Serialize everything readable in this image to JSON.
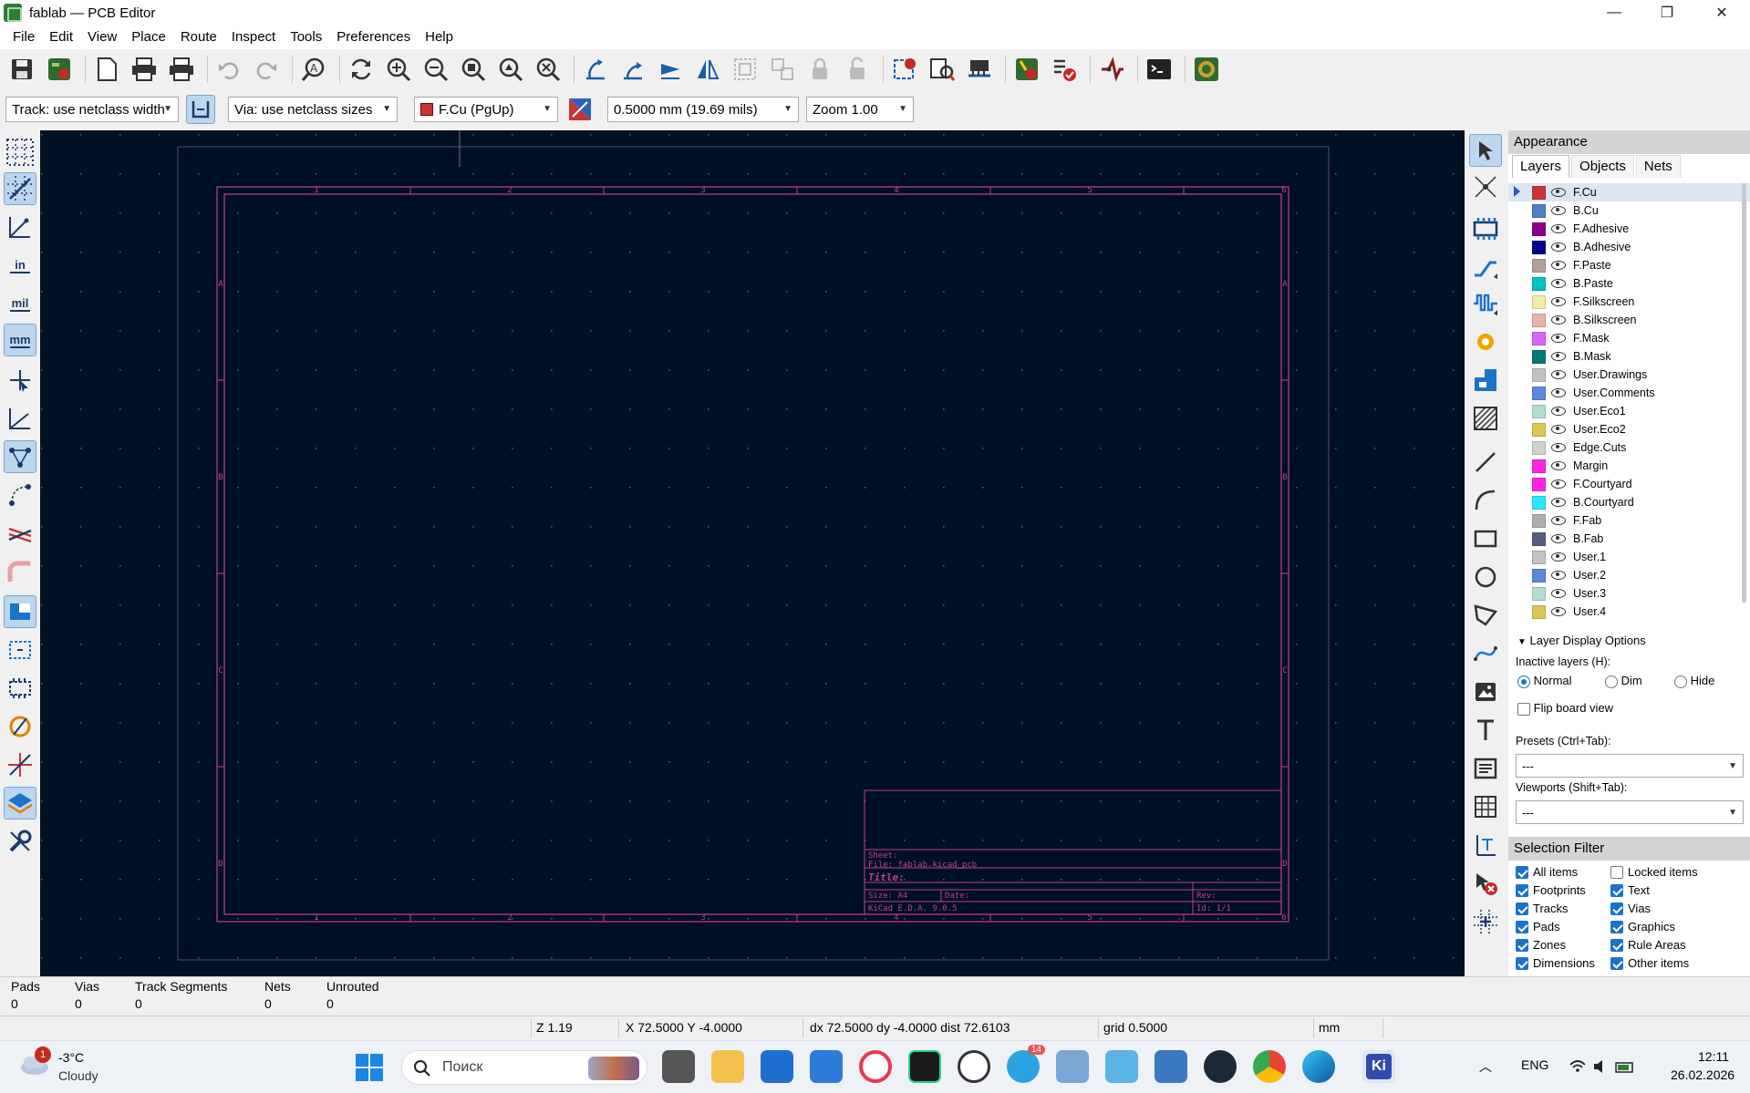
{
  "window": {
    "title": "fablab — PCB Editor",
    "minimize": "—",
    "maximize": "❐",
    "close": "✕"
  },
  "menu": [
    "File",
    "Edit",
    "View",
    "Place",
    "Route",
    "Inspect",
    "Tools",
    "Preferences",
    "Help"
  ],
  "toolbar2": {
    "track_width": "Track: use netclass width",
    "via_size": "Via: use netclass sizes",
    "layer": "F.Cu (PgUp)",
    "grid": "0.5000 mm (19.69 mils)",
    "zoom": "Zoom 1.00"
  },
  "left_toolbar": {
    "inch_label": "in",
    "mil_label": "mil",
    "mm_label": "mm"
  },
  "sheet": {
    "col_labels": [
      "1",
      "2",
      "3",
      "4",
      "5",
      "6"
    ],
    "row_labels": [
      "A",
      "B",
      "C",
      "D"
    ],
    "sheet_label": "Sheet:",
    "file_label": "File: fablab.kicad_pcb",
    "title_label": "Title:",
    "size_label": "Size: A4",
    "date_label": "Date:",
    "rev_label": "Rev:",
    "kicad_label": "KiCad E.D.A. 9.0.5",
    "id_label": "Id: 1/1"
  },
  "appearance": {
    "header": "Appearance",
    "tabs": [
      "Layers",
      "Objects",
      "Nets"
    ],
    "layers": [
      {
        "name": "F.Cu",
        "color": "#c83434"
      },
      {
        "name": "B.Cu",
        "color": "#4d7fc4"
      },
      {
        "name": "F.Adhesive",
        "color": "#8a008a"
      },
      {
        "name": "B.Adhesive",
        "color": "#00008a"
      },
      {
        "name": "F.Paste",
        "color": "#b4a09a"
      },
      {
        "name": "B.Paste",
        "color": "#00c2c2"
      },
      {
        "name": "F.Silkscreen",
        "color": "#f2eda1"
      },
      {
        "name": "B.Silkscreen",
        "color": "#e8b2a7"
      },
      {
        "name": "F.Mask",
        "color": "#d864ff"
      },
      {
        "name": "B.Mask",
        "color": "#027a7a"
      },
      {
        "name": "User.Drawings",
        "color": "#c2c2c2"
      },
      {
        "name": "User.Comments",
        "color": "#5989db"
      },
      {
        "name": "User.Eco1",
        "color": "#b4dbd2"
      },
      {
        "name": "User.Eco2",
        "color": "#d8c852"
      },
      {
        "name": "Edge.Cuts",
        "color": "#d0d2cd"
      },
      {
        "name": "Margin",
        "color": "#ff26e2"
      },
      {
        "name": "F.Courtyard",
        "color": "#ff26e2"
      },
      {
        "name": "B.Courtyard",
        "color": "#26e9ff"
      },
      {
        "name": "F.Fab",
        "color": "#afafaf"
      },
      {
        "name": "B.Fab",
        "color": "#585d84"
      },
      {
        "name": "User.1",
        "color": "#c2c2c2"
      },
      {
        "name": "User.2",
        "color": "#5989db"
      },
      {
        "name": "User.3",
        "color": "#b4dbd2"
      },
      {
        "name": "User.4",
        "color": "#d8c852"
      }
    ],
    "display_options": "Layer Display Options",
    "inactive_label": "Inactive layers (H):",
    "inactive_options": [
      "Normal",
      "Dim",
      "Hide"
    ],
    "flip_label": "Flip board view",
    "presets_label": "Presets (Ctrl+Tab):",
    "presets_value": "---",
    "viewports_label": "Viewports (Shift+Tab):",
    "viewports_value": "---"
  },
  "selection_filter": {
    "header": "Selection Filter",
    "items": [
      {
        "label": "All items",
        "checked": true
      },
      {
        "label": "Locked items",
        "checked": false
      },
      {
        "label": "Footprints",
        "checked": true
      },
      {
        "label": "Text",
        "checked": true
      },
      {
        "label": "Tracks",
        "checked": true
      },
      {
        "label": "Vias",
        "checked": true
      },
      {
        "label": "Pads",
        "checked": true
      },
      {
        "label": "Graphics",
        "checked": true
      },
      {
        "label": "Zones",
        "checked": true
      },
      {
        "label": "Rule Areas",
        "checked": true
      },
      {
        "label": "Dimensions",
        "checked": true
      },
      {
        "label": "Other items",
        "checked": true
      }
    ]
  },
  "message_panel": [
    {
      "label": "Pads",
      "value": "0"
    },
    {
      "label": "Vias",
      "value": "0"
    },
    {
      "label": "Track Segments",
      "value": "0"
    },
    {
      "label": "Nets",
      "value": "0"
    },
    {
      "label": "Unrouted",
      "value": "0"
    }
  ],
  "status": {
    "zoom": "Z 1.19",
    "coords": "X 72.5000  Y -4.0000",
    "delta": "dx 72.5000  dy -4.0000  dist 72.6103",
    "grid": "grid 0.5000",
    "units": "mm"
  },
  "taskbar": {
    "weather_temp": "-3°C",
    "weather_desc": "Cloudy",
    "weather_badge": "1",
    "search_placeholder": "Поиск",
    "telegram_badge": "14",
    "kicad_label": "Ki",
    "lang": "ENG",
    "time": "12:11",
    "date": "26.02.2026"
  }
}
